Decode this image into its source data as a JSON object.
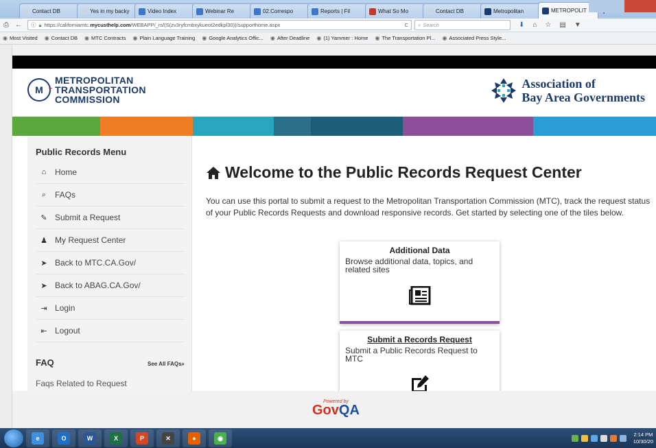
{
  "browser": {
    "tabs": [
      {
        "label": "Contact DB",
        "color": "#c9d6e6"
      },
      {
        "label": "Yes in my backy",
        "color": "#c9d6e6"
      },
      {
        "label": "Video Index",
        "color": "#3b76c9"
      },
      {
        "label": "Webinar Re",
        "color": "#3b76c9"
      },
      {
        "label": "02.Correspo",
        "color": "#3b76c9"
      },
      {
        "label": "Reports | Fil",
        "color": "#3b76c9"
      },
      {
        "label": "What So Mo",
        "color": "#c0392b"
      },
      {
        "label": "Contact DB",
        "color": "#c9d6e6"
      },
      {
        "label": "Metropolitan",
        "color": "#1b3a6b"
      },
      {
        "label": "METROPOLIT",
        "color": "#1b3a6b",
        "active": true
      }
    ],
    "url_prefix": "https://californiamtc.",
    "url_domain": "mycusthelp.com",
    "url_path": "/WEBAPP/_rs/(S(zv3ryfcmbxykueot2edkpl30))/supporthome.aspx",
    "search_placeholder": "Search",
    "bookmarks": [
      "Most Visited",
      "Contact DB",
      "MTC Contracts",
      "Plain Language Training",
      "Google Analytics Offic...",
      "After Deadline",
      "(1) Yammer : Home",
      "The Transportation Pl...",
      "Associated Press Style..."
    ]
  },
  "header": {
    "mtc_line1": "METROPOLITAN",
    "mtc_line2": "TRANSPORTATION",
    "mtc_line3": "COMMISSION",
    "abag_line1": "Association of",
    "abag_line2": "Bay Area Governments"
  },
  "colorbar": [
    "#5aa83d",
    "#ee7d25",
    "#2aa5bd",
    "#2b6f89",
    "#1d5d78",
    "#8e4f9a",
    "#2c9cd6"
  ],
  "sidebar": {
    "title": "Public Records Menu",
    "items": [
      {
        "label": "Home",
        "icon": "home-icon"
      },
      {
        "label": "FAQs",
        "icon": "search-icon"
      },
      {
        "label": "Submit a Request",
        "icon": "edit-icon"
      },
      {
        "label": "My Request Center",
        "icon": "user-icon"
      },
      {
        "label": "Back to MTC.CA.Gov/",
        "icon": "pointer-icon"
      },
      {
        "label": "Back to ABAG.CA.Gov/",
        "icon": "pointer-icon"
      },
      {
        "label": "Login",
        "icon": "login-icon"
      },
      {
        "label": "Logout",
        "icon": "logout-icon"
      }
    ],
    "faq_title": "FAQ",
    "faq_link": "See All FAQs",
    "faq_first": "Faqs Related to Request"
  },
  "main": {
    "title": "Welcome to the Public Records Request Center",
    "intro": "You can use this portal to submit a request to the Metropolitan Transportation Commission (MTC), track the request status of your Public Records Requests and download responsive records. Get started by selecting one of the tiles below.",
    "tiles": [
      {
        "title": "Additional Data",
        "desc": "Browse additional data, topics, and related sites",
        "icon": "newspaper-icon"
      },
      {
        "title": "Submit a Records Request",
        "desc": "Submit a Public Records Request to MTC",
        "icon": "edit-icon"
      }
    ]
  },
  "footer": {
    "powered_by": "Powered by",
    "brand_gov": "Gov",
    "brand_qa": "QA"
  },
  "taskbar": {
    "apps": [
      "ie-icon",
      "outlook-icon",
      "word-icon",
      "excel-icon",
      "powerpoint-icon",
      "xbox-icon",
      "firefox-icon",
      "chrome-icon"
    ],
    "time": "2:14 PM",
    "date": "10/30/20"
  }
}
